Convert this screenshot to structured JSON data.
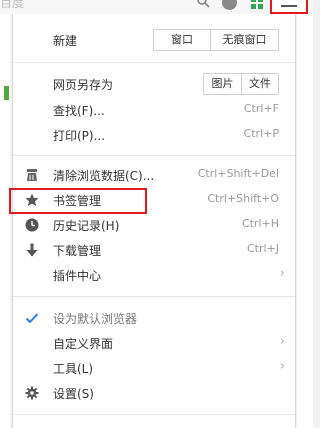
{
  "toolbar": {
    "address_text": "百度"
  },
  "menu": {
    "new": {
      "label": "新建",
      "btn_window": "窗口",
      "btn_incognito": "无痕窗口"
    },
    "save_as": {
      "label": "网页另存为",
      "btn_image": "图片",
      "btn_file": "文件"
    },
    "find": {
      "label": "查找(F)...",
      "shortcut": "Ctrl+F"
    },
    "print": {
      "label": "打印(P)...",
      "shortcut": "Ctrl+P"
    },
    "clear_data": {
      "label": "清除浏览数据(C)...",
      "shortcut": "Ctrl+Shift+Del"
    },
    "bookmarks": {
      "label": "书签管理",
      "shortcut": "Ctrl+Shift+O"
    },
    "history": {
      "label": "历史记录(H)",
      "shortcut": "Ctrl+H"
    },
    "downloads": {
      "label": "下载管理",
      "shortcut": "Ctrl+J"
    },
    "plugins": {
      "label": "插件中心"
    },
    "default_browser": {
      "label": "设为默认浏览器"
    },
    "customize": {
      "label": "自定义界面"
    },
    "tools": {
      "label": "工具(L)"
    },
    "settings": {
      "label": "设置(S)"
    }
  },
  "colors": {
    "highlight": "#e31a1c",
    "check": "#2b7de9",
    "apps_icon": "#2fa84f"
  }
}
